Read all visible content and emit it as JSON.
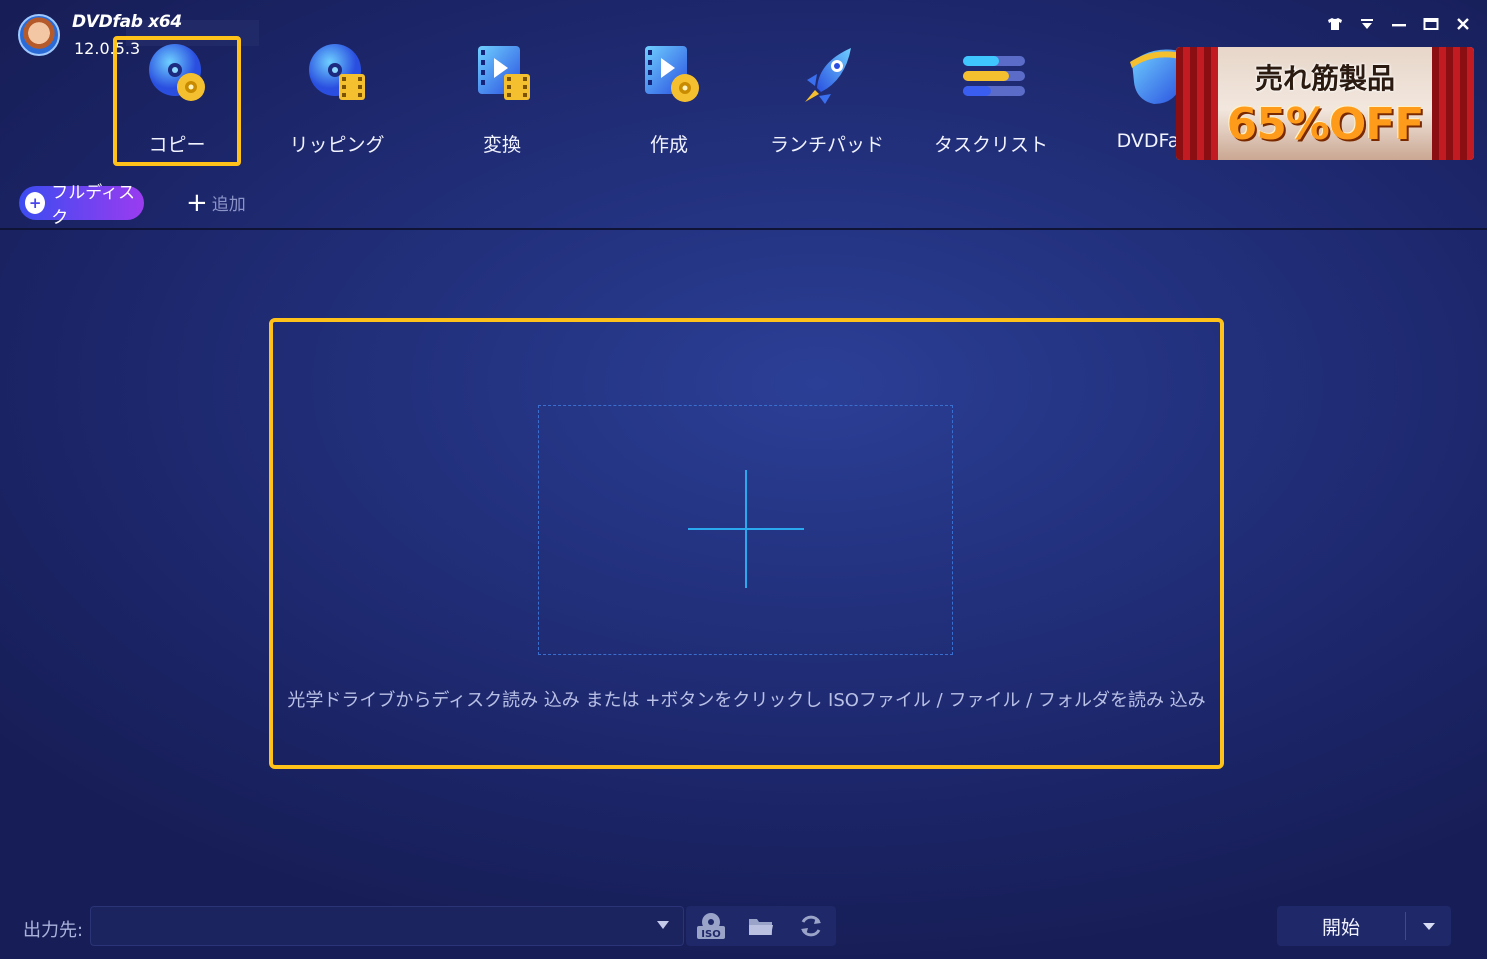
{
  "app": {
    "logo_text": "DVDfab x64",
    "version": "12.0.5.3"
  },
  "modules": [
    {
      "label": "コピー",
      "icon": "disc-copy-icon",
      "active": true
    },
    {
      "label": "リッピング",
      "icon": "disc-ripper-icon",
      "active": false
    },
    {
      "label": "変換",
      "icon": "video-converter-icon",
      "active": false
    },
    {
      "label": "作成",
      "icon": "disc-creator-icon",
      "active": false
    },
    {
      "label": "ランチパッド",
      "icon": "rocket-icon",
      "active": false
    },
    {
      "label": "タスクリスト",
      "icon": "task-list-icon",
      "active": false
    },
    {
      "label": "DVDFab",
      "icon": "dvdfab-product-icon",
      "active": false
    }
  ],
  "ad": {
    "line1": "売れ筋製品",
    "line2": "65%OFF"
  },
  "window_controls": [
    "skin-icon",
    "menu-dropdown-icon",
    "minimize-icon",
    "maximize-icon",
    "close-icon"
  ],
  "subbar": {
    "mode_label": "フルディスク",
    "add_label": "追加"
  },
  "drop_zone": {
    "hint": "光学ドライブからディスク読み 込み または +ボタンをクリックし ISOファイル / ファイル / フォルダを読み 込み"
  },
  "output": {
    "label": "出力先:",
    "value": "",
    "tools": [
      "iso-icon",
      "folder-icon",
      "refresh-icon"
    ]
  },
  "start": {
    "label": "開始"
  },
  "colors": {
    "accent_highlight": "#ffc21a",
    "background": "#22307c",
    "plus_line": "#2aa9ee"
  }
}
